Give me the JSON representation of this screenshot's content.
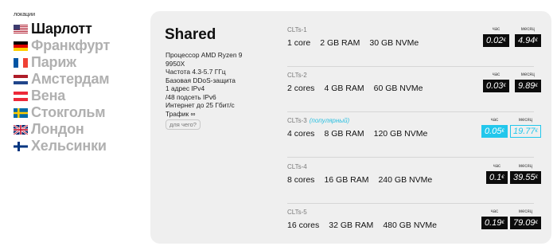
{
  "locations": {
    "label": "локации",
    "items": [
      {
        "name": "Шарлотт",
        "flag": "us-flag-icon",
        "active": true
      },
      {
        "name": "Франкфурт",
        "flag": "de-flag-icon",
        "active": false
      },
      {
        "name": "Париж",
        "flag": "fr-flag-icon",
        "active": false
      },
      {
        "name": "Амстердам",
        "flag": "nl-flag-icon",
        "active": false
      },
      {
        "name": "Вена",
        "flag": "at-flag-icon",
        "active": false
      },
      {
        "name": "Стокгольм",
        "flag": "se-flag-icon",
        "active": false
      },
      {
        "name": "Лондон",
        "flag": "gb-flag-icon",
        "active": false
      },
      {
        "name": "Хельсинки",
        "flag": "fi-flag-icon",
        "active": false
      }
    ]
  },
  "plan": {
    "title": "Shared",
    "specs": [
      "Процессор AMD Ryzen 9 9950X",
      "Частота 4.3-5.7 ГГц",
      "Базовая DDoS-защита",
      "1 адрес IPv4",
      "/48 подсеть IPv6",
      "Интернет до 25 Гбит/с",
      "Трафик ∞"
    ],
    "why_button": "для чего?"
  },
  "pricing_labels": {
    "hourly": "час",
    "monthly": "месяц"
  },
  "tiers": [
    {
      "name": "CLTs-1",
      "popular": "",
      "cores": "1 core",
      "ram": "2 GB RAM",
      "disk": "30 GB NVMe",
      "hourly": "0.02",
      "monthly": "4.94",
      "currency": "€"
    },
    {
      "name": "CLTs-2",
      "popular": "",
      "cores": "2 cores",
      "ram": "4 GB RAM",
      "disk": "60 GB NVMe",
      "hourly": "0.03",
      "monthly": "9.89",
      "currency": "€"
    },
    {
      "name": "CLTs-3",
      "popular": "(популярный)",
      "cores": "4 cores",
      "ram": "8 GB RAM",
      "disk": "120 GB NVMe",
      "hourly": "0.05",
      "monthly": "19.77",
      "currency": "€"
    },
    {
      "name": "CLTs-4",
      "popular": "",
      "cores": "8 cores",
      "ram": "16 GB RAM",
      "disk": "240 GB NVMe",
      "hourly": "0.1",
      "monthly": "39.55",
      "currency": "€"
    },
    {
      "name": "CLTs-5",
      "popular": "",
      "cores": "16 cores",
      "ram": "32 GB RAM",
      "disk": "480 GB NVMe",
      "hourly": "0.19",
      "monthly": "79.09",
      "currency": "€"
    }
  ],
  "colors": {
    "accent": "#22c7ec",
    "price_bg": "#0c0c0c",
    "panel_bg": "#efefef",
    "inactive_location": "#b0b0b0"
  }
}
